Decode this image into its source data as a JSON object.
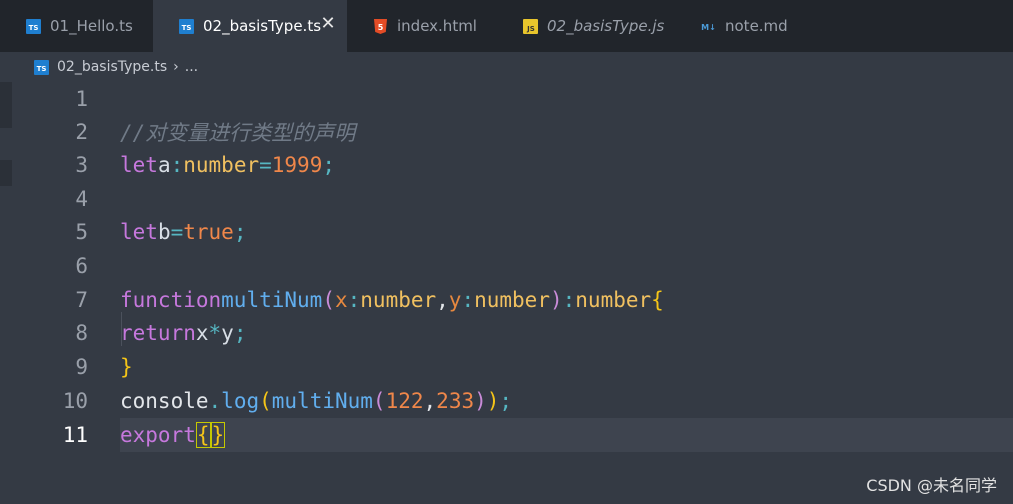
{
  "tabs": [
    {
      "label": "01_Hello.ts",
      "icon": "typescript-file-icon",
      "active": false
    },
    {
      "label": "02_basisType.ts",
      "icon": "typescript-file-icon",
      "active": true
    },
    {
      "label": "index.html",
      "icon": "html-file-icon",
      "active": false
    },
    {
      "label": "02_basisType.js",
      "icon": "javascript-file-icon",
      "active": false
    },
    {
      "label": "note.md",
      "icon": "markdown-file-icon",
      "active": false
    }
  ],
  "close_glyph": "✕",
  "breadcrumb": {
    "file": "02_basisType.ts",
    "separator": "›",
    "ellipsis": "..."
  },
  "line_numbers": [
    "1",
    "2",
    "3",
    "4",
    "5",
    "6",
    "7",
    "8",
    "9",
    "10",
    "11"
  ],
  "code": {
    "l2": {
      "comment": "//对变量进行类型的声明"
    },
    "l3": {
      "kw": "let",
      "var": "a",
      "colon": ":",
      "type": "number",
      "eq": "=",
      "num": "1999",
      "semi": ";"
    },
    "l5": {
      "kw": "let",
      "var": "b",
      "eq": "=",
      "bool": "true",
      "semi": ";"
    },
    "l7": {
      "kw": "function",
      "fn": "multiNum",
      "lparen": "(",
      "p1": "x",
      "c1": ":",
      "t1": "number",
      "comma": ",",
      "p2": "y",
      "c2": ":",
      "t2": "number",
      "rparen": ")",
      "c3": ":",
      "ret": "number",
      "brace": "{"
    },
    "l8": {
      "kw": "return",
      "a": "x",
      "op": "*",
      "b": "y",
      "semi": ";"
    },
    "l9": {
      "brace": "}"
    },
    "l10": {
      "obj": "console",
      "dot": ".",
      "method": "log",
      "lp1": "(",
      "fn": "multiNum",
      "lp2": "(",
      "n1": "122",
      "comma": ",",
      "n2": "233",
      "rp2": ")",
      "rp1": ")",
      "semi": ";"
    },
    "l11": {
      "kw": "export",
      "lbrace": "{",
      "rbrace": "}"
    }
  },
  "watermark": "CSDN @未名同学",
  "colors": {
    "editor_bg": "#343a44",
    "tabbar_bg": "#21252b",
    "keyword": "#c678dd",
    "function": "#61aeee",
    "number": "#f0874a",
    "type": "#f0c060"
  }
}
